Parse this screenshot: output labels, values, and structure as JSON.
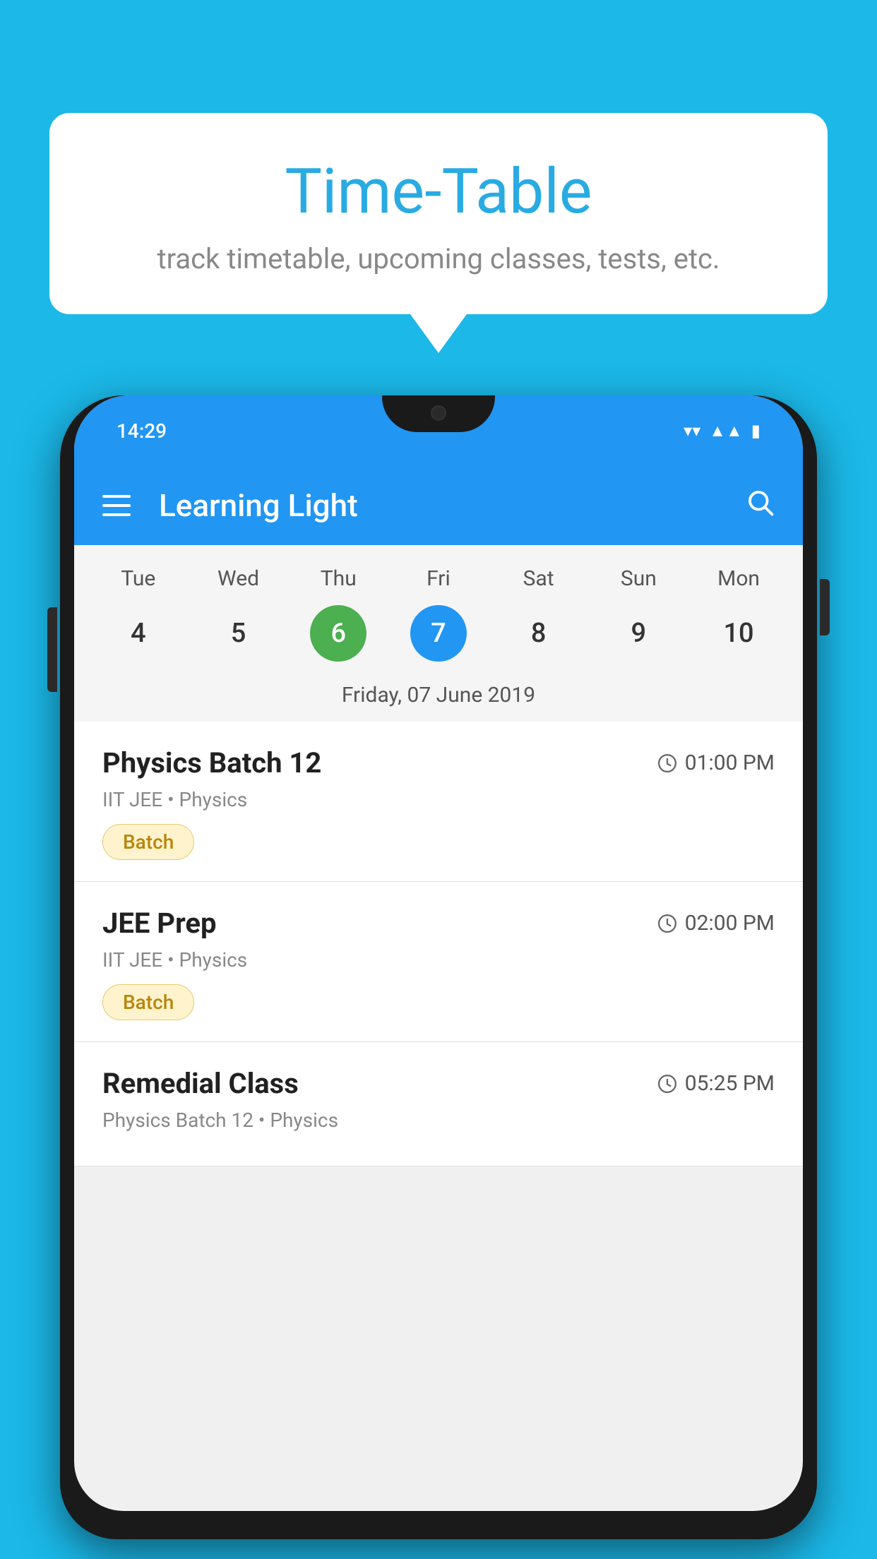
{
  "background": {
    "color": "#1bb8e8"
  },
  "speech_bubble": {
    "title": "Time-Table",
    "subtitle": "track timetable, upcoming classes, tests, etc."
  },
  "phone": {
    "status_bar": {
      "time": "14:29"
    },
    "app_bar": {
      "title": "Learning Light",
      "menu_icon": "hamburger-icon",
      "search_icon": "search-icon"
    },
    "calendar": {
      "days": [
        "Tue",
        "Wed",
        "Thu",
        "Fri",
        "Sat",
        "Sun",
        "Mon"
      ],
      "dates": [
        {
          "num": "4",
          "state": "normal"
        },
        {
          "num": "5",
          "state": "normal"
        },
        {
          "num": "6",
          "state": "today"
        },
        {
          "num": "7",
          "state": "selected"
        },
        {
          "num": "8",
          "state": "normal"
        },
        {
          "num": "9",
          "state": "normal"
        },
        {
          "num": "10",
          "state": "normal"
        }
      ],
      "selected_date_label": "Friday, 07 June 2019"
    },
    "schedule": [
      {
        "title": "Physics Batch 12",
        "time": "01:00 PM",
        "subtitle": "IIT JEE • Physics",
        "badge": "Batch"
      },
      {
        "title": "JEE Prep",
        "time": "02:00 PM",
        "subtitle": "IIT JEE • Physics",
        "badge": "Batch"
      },
      {
        "title": "Remedial Class",
        "time": "05:25 PM",
        "subtitle": "Physics Batch 12 • Physics",
        "badge": null
      }
    ]
  }
}
